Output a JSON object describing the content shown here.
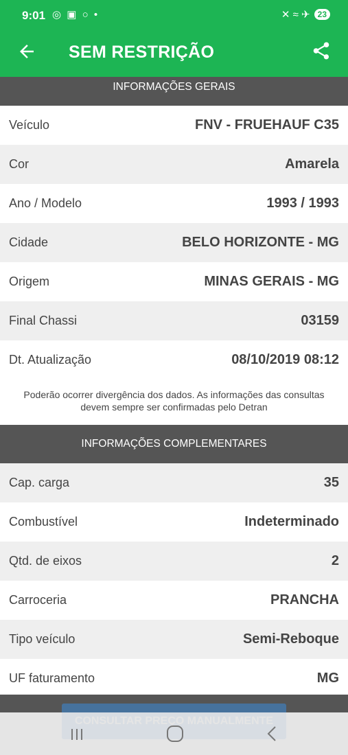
{
  "status_bar": {
    "time": "9:01",
    "left_icons": "◎ ▣ ○ •",
    "right_icons": "✕ ≈ ✈",
    "battery": "23"
  },
  "app_bar": {
    "title": "SEM RESTRIÇÃO",
    "back_icon": "arrow-left",
    "share_icon": "share"
  },
  "general_info": {
    "header": "INFORMAÇÕES GERAIS",
    "rows": [
      {
        "label": "Veículo",
        "value": "FNV - FRUEHAUF C35"
      },
      {
        "label": "Cor",
        "value": "Amarela"
      },
      {
        "label": "Ano / Modelo",
        "value": "1993 / 1993"
      },
      {
        "label": "Cidade",
        "value": "BELO HORIZONTE - MG"
      },
      {
        "label": "Origem",
        "value": "MINAS GERAIS - MG"
      },
      {
        "label": "Final Chassi",
        "value": "03159"
      },
      {
        "label": "Dt. Atualização",
        "value": "08/10/2019 08:12"
      }
    ],
    "disclaimer": "Poderão ocorrer divergência dos dados. As informações das consultas devem sempre ser confirmadas pelo Detran"
  },
  "complementary_info": {
    "header": "INFORMAÇÕES COMPLEMENTARES",
    "rows": [
      {
        "label": "Cap. carga",
        "value": "35"
      },
      {
        "label": "Combustível",
        "value": "Indeterminado"
      },
      {
        "label": "Qtd. de eixos",
        "value": "2"
      },
      {
        "label": "Carroceria",
        "value": "PRANCHA"
      },
      {
        "label": "Tipo veículo",
        "value": "Semi-Reboque"
      },
      {
        "label": "UF faturamento",
        "value": "MG"
      }
    ]
  },
  "actions": {
    "consult_label": "CONSULTAR PREÇO MANUALMENTE"
  },
  "colors": {
    "primary_green": "#1db554",
    "section_header": "#555555",
    "row_alt": "#efefef",
    "button_blue": "#3b8bd9"
  }
}
